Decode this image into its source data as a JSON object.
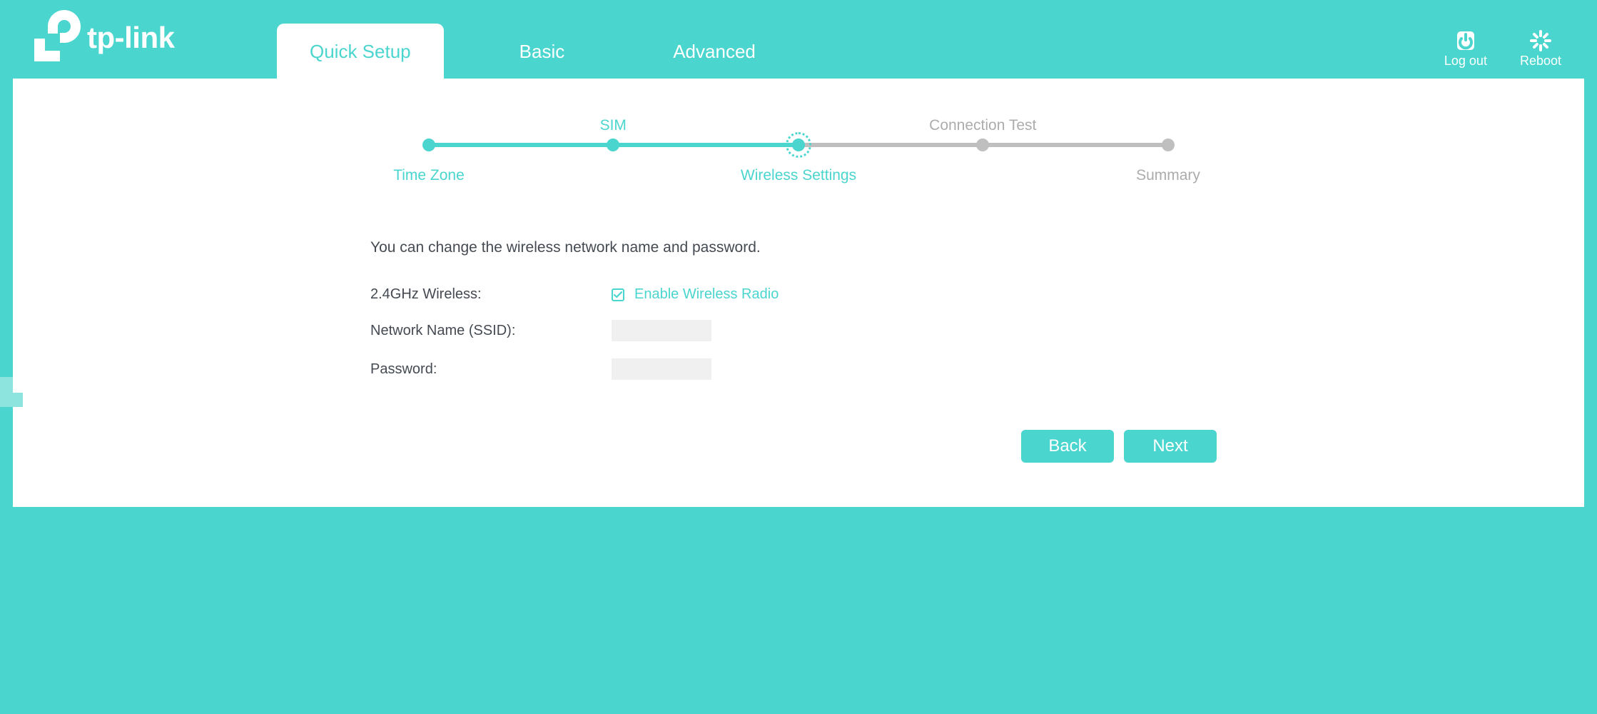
{
  "brand": {
    "name": "tp-link"
  },
  "nav": {
    "tabs": [
      {
        "label": "Quick Setup",
        "active": true
      },
      {
        "label": "Basic",
        "active": false
      },
      {
        "label": "Advanced",
        "active": false
      }
    ]
  },
  "header_actions": {
    "logout_label": "Log out",
    "reboot_label": "Reboot"
  },
  "stepper": {
    "steps": [
      {
        "label": "Time Zone",
        "pos": 3.7,
        "align": "bottom",
        "state": "done"
      },
      {
        "label": "SIM",
        "pos": 21.3,
        "align": "top",
        "state": "done"
      },
      {
        "label": "Wireless Settings",
        "pos": 39.0,
        "align": "bottom",
        "state": "current"
      },
      {
        "label": "Connection Test",
        "pos": 56.6,
        "align": "top",
        "state": "todo"
      },
      {
        "label": "Summary",
        "pos": 74.3,
        "align": "bottom",
        "state": "todo"
      }
    ],
    "fill_percent": 50
  },
  "form": {
    "intro": "You can change the wireless network name and password.",
    "wireless_label": "2.4GHz Wireless:",
    "enable_radio_label": "Enable Wireless Radio",
    "enable_radio_checked": true,
    "ssid_label": "Network Name (SSID):",
    "ssid_value": "",
    "password_label": "Password:",
    "password_value": ""
  },
  "buttons": {
    "back": "Back",
    "next": "Next"
  }
}
